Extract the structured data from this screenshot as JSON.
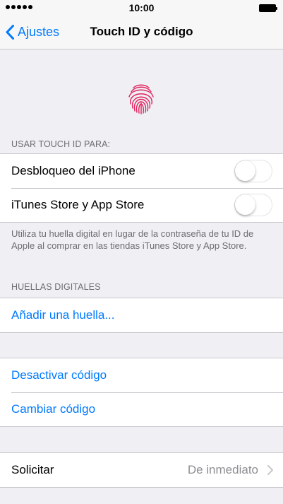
{
  "status_bar": {
    "time": "10:00"
  },
  "nav": {
    "back_label": "Ajustes",
    "title": "Touch ID y código"
  },
  "colors": {
    "accent": "#007aff",
    "fingerprint": "#e0245e",
    "background": "#efeff4"
  },
  "touch_id": {
    "header": "USAR TOUCH ID PARA:",
    "items": [
      {
        "label": "Desbloqueo del iPhone",
        "enabled": false
      },
      {
        "label": "iTunes Store y App Store",
        "enabled": false
      }
    ],
    "footer": "Utiliza tu huella digital en lugar de la contraseña de tu ID de Apple al comprar en las tiendas iTunes Store y App Store."
  },
  "fingerprints": {
    "header": "HUELLAS DIGITALES",
    "add_label": "Añadir una huella..."
  },
  "passcode": {
    "turn_off_label": "Desactivar código",
    "change_label": "Cambiar código"
  },
  "require": {
    "label": "Solicitar",
    "value": "De inmediato"
  }
}
